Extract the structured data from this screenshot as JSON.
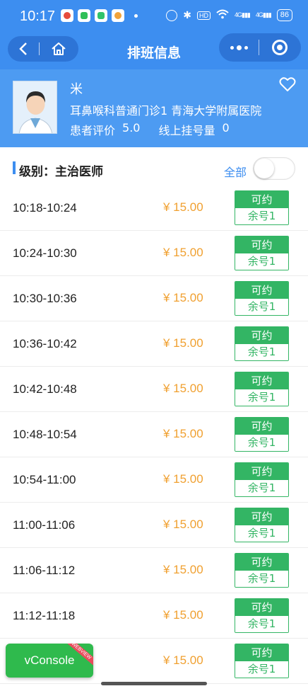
{
  "status_bar": {
    "time": "10:17",
    "battery": "86",
    "network_labels": [
      "HD",
      "4G",
      "4G"
    ]
  },
  "nav": {
    "title": "排班信息"
  },
  "doctor": {
    "name": "米",
    "department": "耳鼻喉科普通门诊1 青海大学附属医院",
    "rating_label": "患者评价",
    "rating_value": "5.0",
    "booking_label": "线上挂号量",
    "booking_value": "0"
  },
  "level_header": {
    "level_label": "级别：主治医师",
    "filter_label": "全部",
    "toggle_on": false
  },
  "slots": [
    {
      "time": "10:18-10:24",
      "price": "¥ 15.00",
      "status": "可约",
      "remaining": "余号1"
    },
    {
      "time": "10:24-10:30",
      "price": "¥ 15.00",
      "status": "可约",
      "remaining": "余号1"
    },
    {
      "time": "10:30-10:36",
      "price": "¥ 15.00",
      "status": "可约",
      "remaining": "余号1"
    },
    {
      "time": "10:36-10:42",
      "price": "¥ 15.00",
      "status": "可约",
      "remaining": "余号1"
    },
    {
      "time": "10:42-10:48",
      "price": "¥ 15.00",
      "status": "可约",
      "remaining": "余号1"
    },
    {
      "time": "10:48-10:54",
      "price": "¥ 15.00",
      "status": "可约",
      "remaining": "余号1"
    },
    {
      "time": "10:54-11:00",
      "price": "¥ 15.00",
      "status": "可约",
      "remaining": "余号1"
    },
    {
      "time": "11:00-11:06",
      "price": "¥ 15.00",
      "status": "可约",
      "remaining": "余号1"
    },
    {
      "time": "11:06-11:12",
      "price": "¥ 15.00",
      "status": "可约",
      "remaining": "余号1"
    },
    {
      "time": "11:12-11:18",
      "price": "¥ 15.00",
      "status": "可约",
      "remaining": "余号1"
    },
    {
      "time": "",
      "price": "¥ 15.00",
      "status": "可约",
      "remaining": "余号1"
    }
  ],
  "vconsole": {
    "label": "vConsole",
    "ribbon": "WEBVIEW"
  },
  "colors": {
    "primary_blue": "#3d8ef0",
    "header_blue": "#4d9bf2",
    "available_green": "#33b564",
    "price_orange": "#f0a030"
  }
}
